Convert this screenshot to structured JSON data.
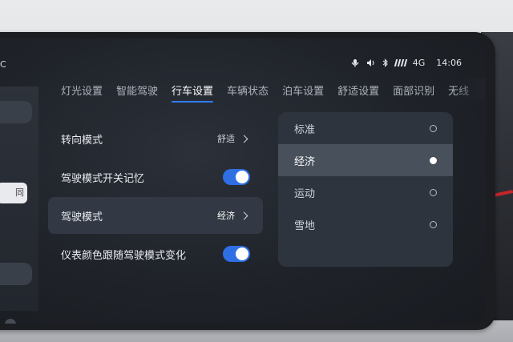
{
  "status": {
    "temp_fragment": "C",
    "network": "4G",
    "time": "14:06",
    "icons": [
      "voice-icon",
      "volume-icon",
      "bluetooth-icon",
      "signal-icon"
    ]
  },
  "tabs": [
    {
      "label": "灯光设置",
      "active": false
    },
    {
      "label": "智能驾驶",
      "active": false
    },
    {
      "label": "行车设置",
      "active": true
    },
    {
      "label": "车辆状态",
      "active": false
    },
    {
      "label": "泊车设置",
      "active": false
    },
    {
      "label": "舒适设置",
      "active": false
    },
    {
      "label": "面部识别",
      "active": false
    },
    {
      "label": "无线",
      "active": false
    }
  ],
  "left_panel": {
    "button_fragment": "同"
  },
  "settings": {
    "steering_mode": {
      "label": "转向模式",
      "value": "舒适"
    },
    "drive_mode_memory": {
      "label": "驾驶模式开关记忆",
      "on": true
    },
    "drive_mode": {
      "label": "驾驶模式",
      "value": "经济"
    },
    "cluster_color_follow": {
      "label": "仪表颜色跟随驾驶模式变化",
      "on": true
    }
  },
  "drive_mode_options": [
    {
      "label": "标准",
      "selected": false
    },
    {
      "label": "经济",
      "selected": true
    },
    {
      "label": "运动",
      "selected": false
    },
    {
      "label": "雪地",
      "selected": false
    }
  ],
  "colors": {
    "accent": "#2f7df6",
    "toggle_on": "#2f6fe4",
    "screen_bg": "#1f2329"
  }
}
